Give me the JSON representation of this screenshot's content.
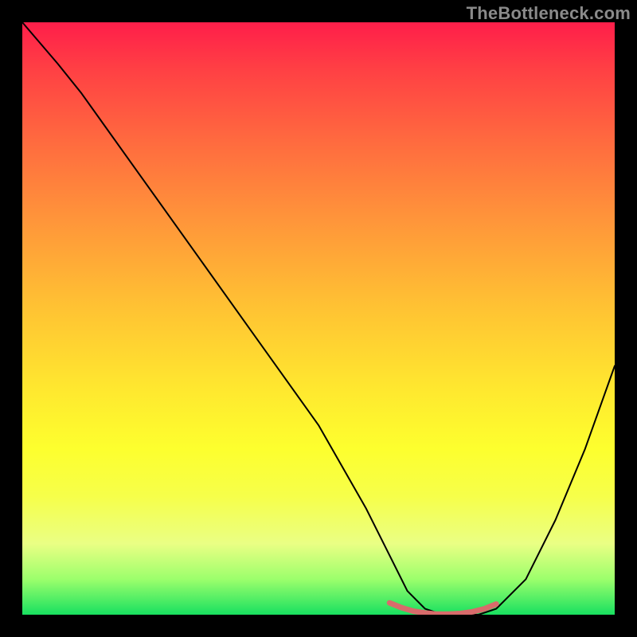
{
  "watermark": "TheBottleneck.com",
  "chart_data": {
    "type": "line",
    "title": "",
    "xlabel": "",
    "ylabel": "",
    "xlim": [
      0,
      100
    ],
    "ylim": [
      0,
      100
    ],
    "grid": false,
    "legend": false,
    "series": [
      {
        "name": "curve",
        "x": [
          0,
          6,
          10,
          20,
          30,
          40,
          50,
          58,
          62,
          65,
          68,
          71,
          74,
          77,
          80,
          85,
          90,
          95,
          100
        ],
        "values": [
          100,
          93,
          88,
          74,
          60,
          46,
          32,
          18,
          10,
          4,
          1,
          0,
          0,
          0,
          1,
          6,
          16,
          28,
          42
        ],
        "color": "#000000",
        "width": 2
      },
      {
        "name": "highlight",
        "x": [
          62,
          64,
          66,
          68,
          70,
          72,
          74,
          76,
          78,
          80
        ],
        "values": [
          2,
          1.2,
          0.6,
          0.3,
          0.1,
          0.1,
          0.2,
          0.5,
          1.0,
          1.8
        ],
        "color": "#d86b6b",
        "width": 7
      }
    ]
  }
}
